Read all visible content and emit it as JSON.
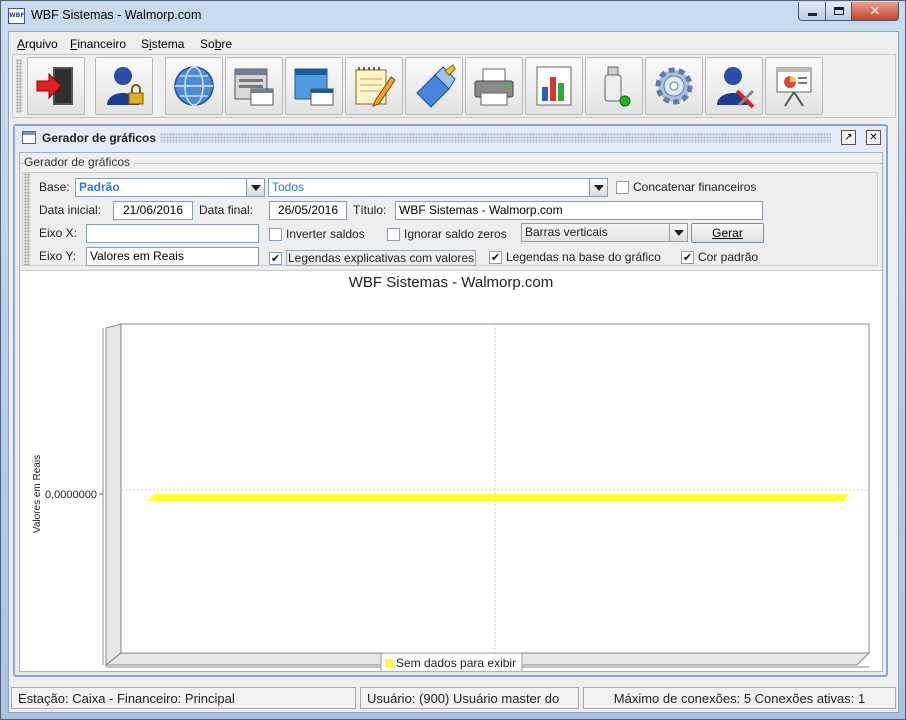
{
  "window": {
    "title": "WBF Sistemas - Walmorp.com",
    "app_icon_text": "WBF"
  },
  "menu": [
    {
      "label": "Arquivo",
      "mnemonic": "A"
    },
    {
      "label": "Financeiro",
      "mnemonic": "F"
    },
    {
      "label": "Sistema",
      "mnemonic": "i"
    },
    {
      "label": "Sobre",
      "mnemonic": "b"
    }
  ],
  "toolbar": [
    {
      "name": "exit-door-icon"
    },
    {
      "name": "user-lock-icon"
    },
    {
      "name": "globe-icon"
    },
    {
      "name": "window-list-icon"
    },
    {
      "name": "window-blue-icon"
    },
    {
      "name": "notepad-pencil-icon"
    },
    {
      "name": "eraser-tool-icon"
    },
    {
      "name": "printer-icon"
    },
    {
      "name": "bar-chart-icon"
    },
    {
      "name": "usb-drive-icon"
    },
    {
      "name": "gear-icon"
    },
    {
      "name": "user-tools-icon"
    },
    {
      "name": "presentation-board-icon"
    }
  ],
  "frame": {
    "title": "Gerador de gráficos",
    "panel_legend": "Gerador de gráficos"
  },
  "form": {
    "base_label": "Base:",
    "base_value": "Padrão",
    "financeiros_value": "Todos",
    "concatenar_label": "Concatenar financeiros",
    "concatenar_checked": false,
    "data_inicial_label": "Data inicial:",
    "data_inicial_value": "21/06/2016",
    "data_final_label": "Data final:",
    "data_final_value": "26/05/2016",
    "titulo_label": "Título:",
    "titulo_value": "WBF Sistemas - Walmorp.com",
    "eixo_x_label": "Eixo X:",
    "eixo_x_value": "",
    "eixo_y_label": "Eixo Y:",
    "eixo_y_value": "Valores em Reais",
    "inverter_label": "Inverter saldos",
    "inverter_checked": false,
    "ignorar_label": "Ignorar saldo zeros",
    "ignorar_checked": false,
    "tipo_value": "Barras verticais",
    "gerar_label": "Gerar",
    "legendas_valores_label": "Legendas explicativas com valores",
    "legendas_valores_checked": true,
    "legendas_base_label": "Legendas na base do gráfico",
    "legendas_base_checked": true,
    "cor_padrao_label": "Cor padrão",
    "cor_padrao_checked": true,
    "check_glyph": "✔"
  },
  "chart_data": {
    "type": "bar",
    "title": "WBF Sistemas - Walmorp.com",
    "xlabel": "",
    "ylabel": "Valores em Reais",
    "y_ticks": [
      "0,0000000"
    ],
    "categories": [
      ""
    ],
    "series": [
      {
        "name": "Sem dados para exibir",
        "values": [
          0
        ],
        "color": "#ffff33"
      }
    ],
    "legend_position": "bottom",
    "grid": true
  },
  "status": {
    "estacao": "Estação: Caixa - Financeiro: Principal",
    "usuario": "Usuário: (900) Usuário master do",
    "conexoes": "Máximo de conexões: 5 Conexões ativas: 1"
  }
}
